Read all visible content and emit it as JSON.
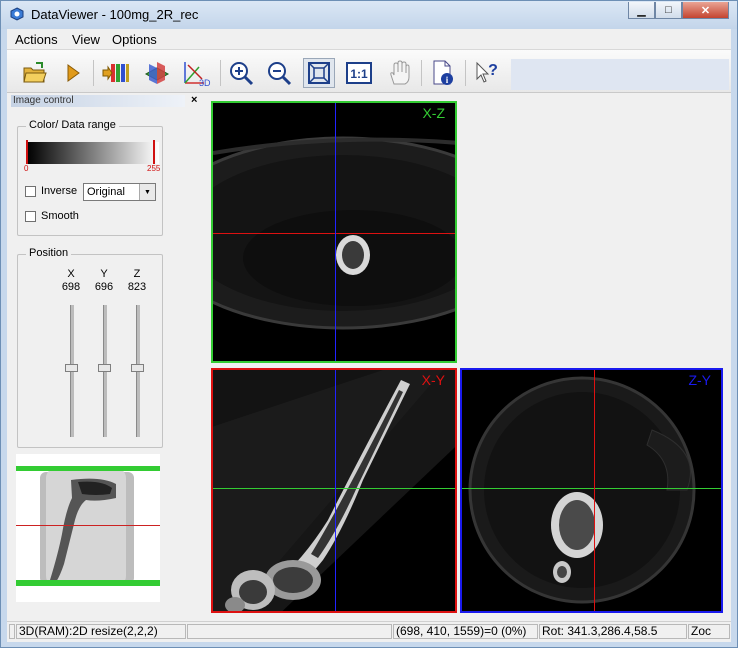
{
  "window": {
    "title": "DataViewer - 100mg_2R_rec",
    "minimize_glyph": "▁",
    "maximize_glyph": "□",
    "close_glyph": "✕"
  },
  "menu": [
    {
      "label": "Actions"
    },
    {
      "label": "View"
    },
    {
      "label": "Options"
    }
  ],
  "toolbar": {
    "buttons": [
      {
        "name": "open-folder-icon"
      },
      {
        "name": "play-icon"
      },
      {
        "name": "volume-render-icon"
      },
      {
        "name": "orthogonal-planes-icon"
      },
      {
        "name": "3d-view-icon",
        "caption": "3D"
      },
      {
        "name": "zoom-in-icon"
      },
      {
        "name": "zoom-out-icon"
      },
      {
        "name": "fit-to-window-icon"
      },
      {
        "name": "actual-size-icon",
        "caption": "1:1"
      },
      {
        "name": "pan-hand-icon"
      },
      {
        "name": "file-info-icon"
      },
      {
        "name": "help-pointer-icon",
        "caption": "?"
      }
    ]
  },
  "image_control": {
    "title": "Image control",
    "close_glyph": "×",
    "color_range": {
      "title": "Color/ Data range",
      "min_label": "0",
      "max_label": "255",
      "inverse_label": "Inverse",
      "inverse_checked": false,
      "mode_value": "Original",
      "smooth_label": "Smooth",
      "smooth_checked": false
    },
    "position": {
      "title": "Position",
      "axes": [
        {
          "axis": "X",
          "value": "698",
          "level": 0.52
        },
        {
          "axis": "Y",
          "value": "696",
          "level": 0.52
        },
        {
          "axis": "Z",
          "value": "823",
          "level": 0.52
        }
      ]
    }
  },
  "views": {
    "xz": {
      "label": "X-Z",
      "color": "#33cc33"
    },
    "xy": {
      "label": "X-Y",
      "color": "#dd1111"
    },
    "zy": {
      "label": "Z-Y",
      "color": "#1a1aee"
    }
  },
  "status": {
    "mode": "3D(RAM):2D resize(2,2,2)",
    "voxel": "(698, 410, 1559)=0 (0%)",
    "rotation": "Rot: 341.3,286.4,58.5",
    "zoom": "Zoc"
  }
}
